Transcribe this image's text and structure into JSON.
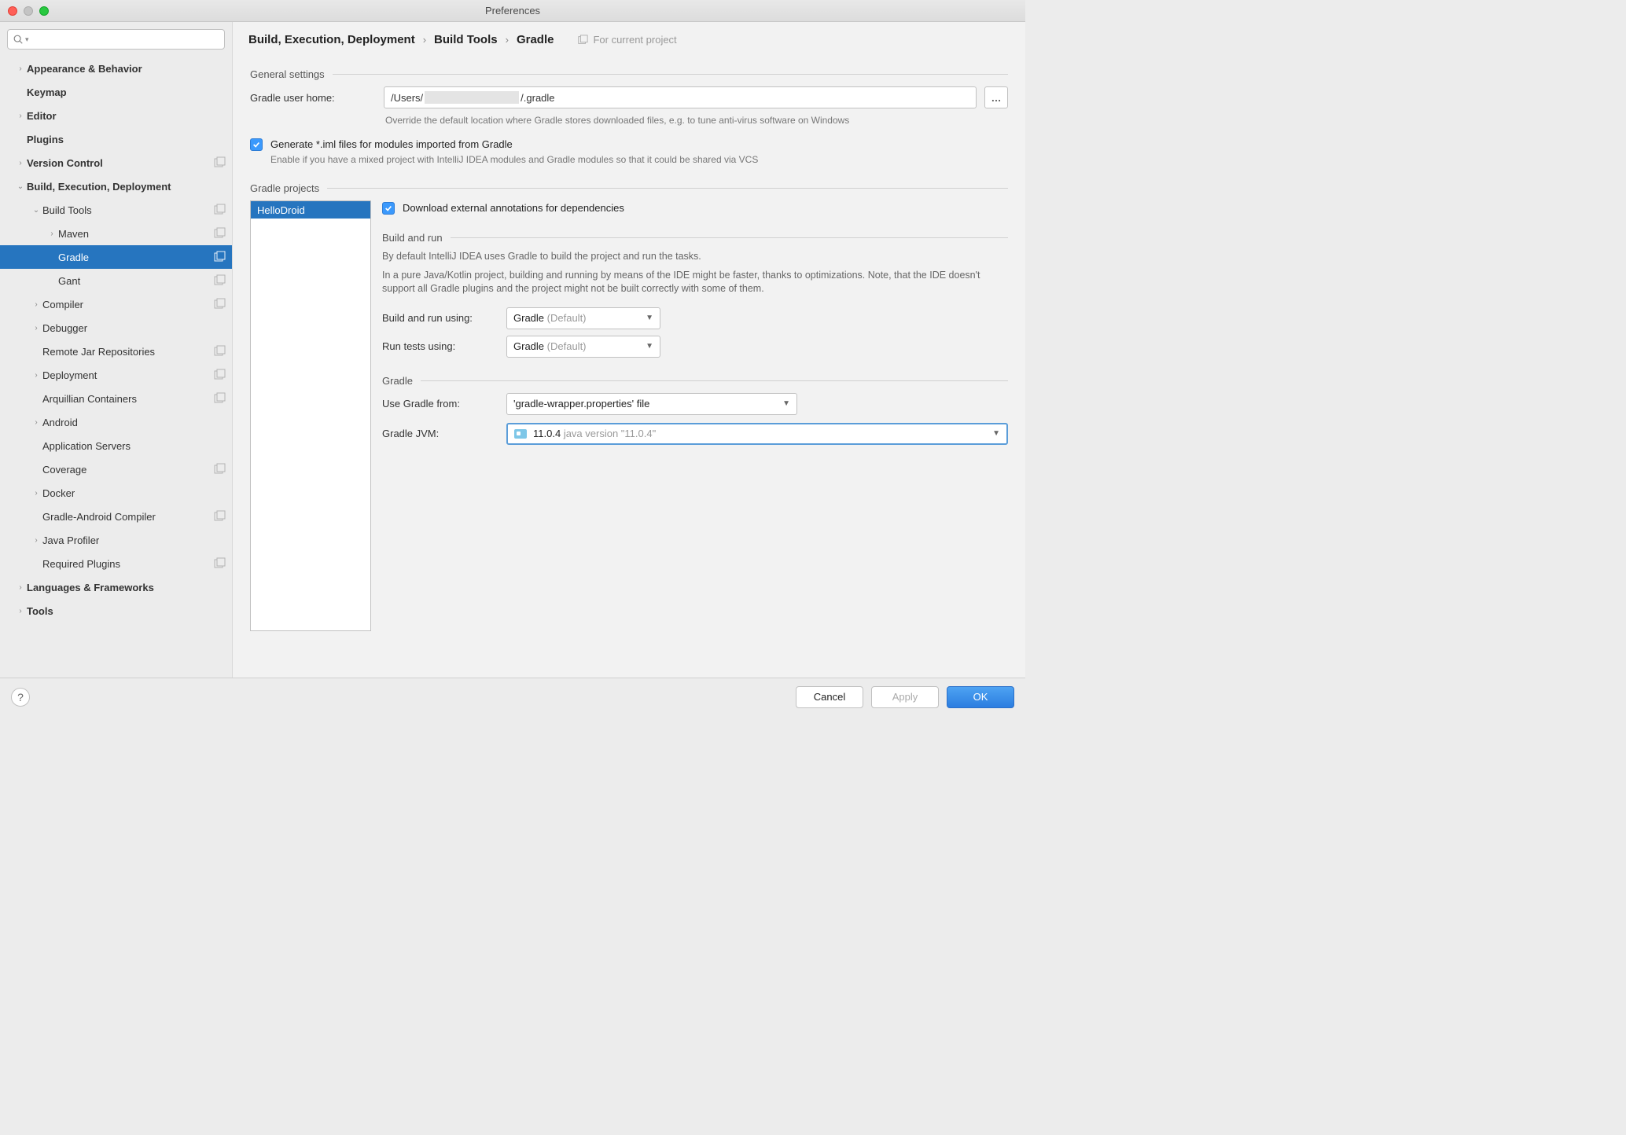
{
  "window": {
    "title": "Preferences"
  },
  "search": {
    "placeholder": ""
  },
  "tree": {
    "appearance": "Appearance & Behavior",
    "keymap": "Keymap",
    "editor": "Editor",
    "plugins": "Plugins",
    "version_control": "Version Control",
    "bed": "Build, Execution, Deployment",
    "build_tools": "Build Tools",
    "maven": "Maven",
    "gradle": "Gradle",
    "gant": "Gant",
    "compiler": "Compiler",
    "debugger": "Debugger",
    "remote_jar": "Remote Jar Repositories",
    "deployment": "Deployment",
    "arquillian": "Arquillian Containers",
    "android": "Android",
    "app_servers": "Application Servers",
    "coverage": "Coverage",
    "docker": "Docker",
    "gradle_android": "Gradle-Android Compiler",
    "java_profiler": "Java Profiler",
    "required_plugins": "Required Plugins",
    "lang_fw": "Languages & Frameworks",
    "tools": "Tools"
  },
  "crumbs": {
    "a": "Build, Execution, Deployment",
    "b": "Build Tools",
    "c": "Gradle",
    "ctx": "For current project"
  },
  "general": {
    "title": "General settings",
    "home_label": "Gradle user home:",
    "home_left": "/Users/",
    "home_right": "/.gradle",
    "home_hint": "Override the default location where Gradle stores downloaded files, e.g. to tune anti-virus software on Windows",
    "gen_iml": "Generate *.iml files for modules imported from Gradle",
    "gen_iml_hint": "Enable if you have a mixed project with IntelliJ IDEA modules and Gradle modules so that it could be shared via VCS"
  },
  "projects": {
    "title": "Gradle projects",
    "items": [
      "HelloDroid"
    ],
    "dl_ext": "Download external annotations for dependencies",
    "build_run": {
      "title": "Build and run",
      "p1": "By default IntelliJ IDEA uses Gradle to build the project and run the tasks.",
      "p2": "In a pure Java/Kotlin project, building and running by means of the IDE might be faster, thanks to optimizations. Note, that the IDE doesn't support all Gradle plugins and the project might not be built correctly with some of them.",
      "build_using_label": "Build and run using:",
      "build_using_value": "Gradle",
      "build_using_suffix": "(Default)",
      "run_tests_label": "Run tests using:",
      "run_tests_value": "Gradle",
      "run_tests_suffix": "(Default)"
    },
    "gradle_sec": {
      "title": "Gradle",
      "use_from_label": "Use Gradle from:",
      "use_from_value": "'gradle-wrapper.properties' file",
      "jvm_label": "Gradle JVM:",
      "jvm_value": "11.0.4",
      "jvm_suffix": "java version \"11.0.4\""
    }
  },
  "footer": {
    "cancel": "Cancel",
    "apply": "Apply",
    "ok": "OK"
  }
}
